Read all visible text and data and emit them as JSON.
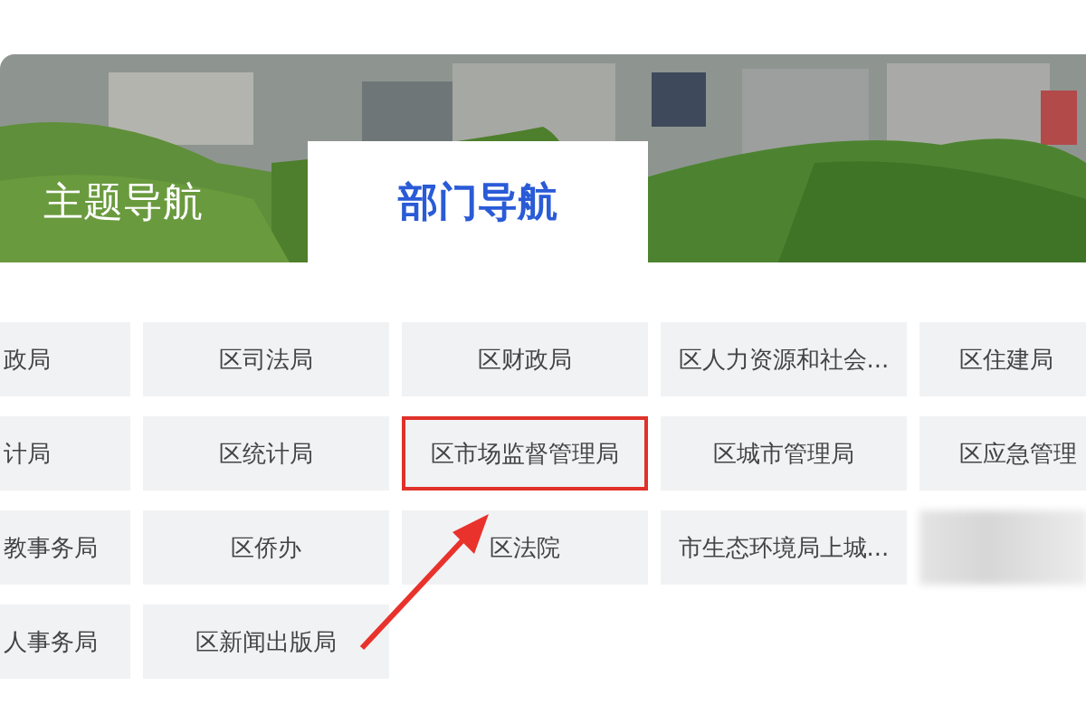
{
  "tabs": [
    {
      "label": "主题导航",
      "selected": false
    },
    {
      "label": "部门导航",
      "selected": true
    }
  ],
  "departments": [
    {
      "cells": [
        {
          "kind": "text",
          "label": "政局",
          "highlighted": false
        },
        {
          "kind": "text",
          "label": "区司法局",
          "highlighted": false
        },
        {
          "kind": "text",
          "label": "区财政局",
          "highlighted": false
        },
        {
          "kind": "text",
          "label": "区人力资源和社会...",
          "highlighted": false
        },
        {
          "kind": "text",
          "label": "区住建局",
          "highlighted": false
        }
      ]
    },
    {
      "cells": [
        {
          "kind": "text",
          "label": "计局",
          "highlighted": false
        },
        {
          "kind": "text",
          "label": "区统计局",
          "highlighted": false
        },
        {
          "kind": "text",
          "label": "区市场监督管理局",
          "highlighted": true
        },
        {
          "kind": "text",
          "label": "区城市管理局",
          "highlighted": false
        },
        {
          "kind": "text",
          "label": "区应急管理",
          "highlighted": false
        }
      ]
    },
    {
      "cells": [
        {
          "kind": "text",
          "label": "教事务局",
          "highlighted": false
        },
        {
          "kind": "text",
          "label": "区侨办",
          "highlighted": false
        },
        {
          "kind": "text",
          "label": "区法院",
          "highlighted": false
        },
        {
          "kind": "text",
          "label": "市生态环境局上城...",
          "highlighted": false
        },
        {
          "kind": "blurred"
        }
      ]
    },
    {
      "cells": [
        {
          "kind": "text",
          "label": "人事务局",
          "highlighted": false
        },
        {
          "kind": "text",
          "label": "区新闻出版局",
          "highlighted": false
        }
      ]
    }
  ]
}
